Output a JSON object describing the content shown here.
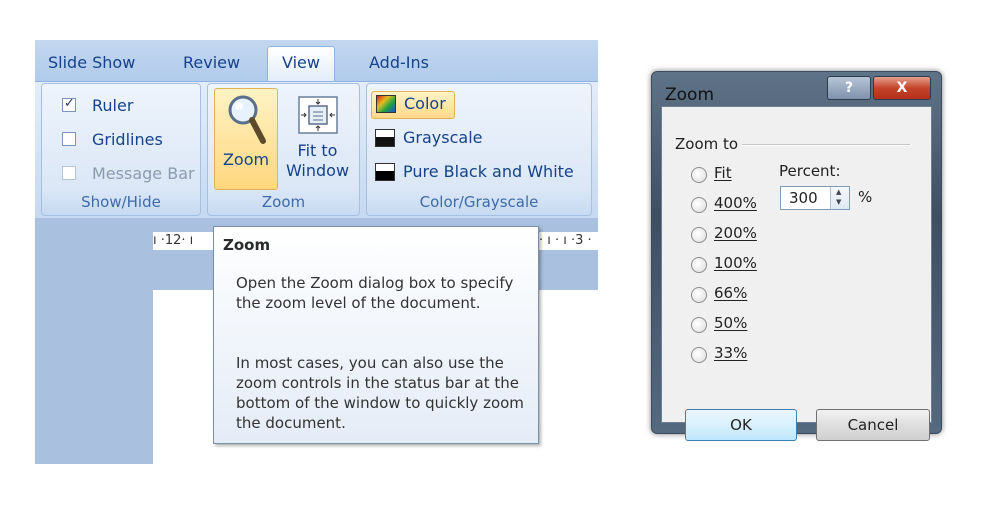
{
  "ribbon": {
    "tabs": [
      {
        "label": "Slide Show",
        "active": false
      },
      {
        "label": "Review",
        "active": false
      },
      {
        "label": "View",
        "active": true
      },
      {
        "label": "Add-Ins",
        "active": false
      }
    ],
    "show_hide": {
      "group_label": "Show/Hide",
      "items": [
        {
          "label": "Ruler",
          "checked": true,
          "enabled": true
        },
        {
          "label": "Gridlines",
          "checked": false,
          "enabled": true
        },
        {
          "label": "Message Bar",
          "checked": false,
          "enabled": false
        }
      ]
    },
    "zoom": {
      "group_label": "Zoom",
      "zoom_button": "Zoom",
      "fit_line1": "Fit to",
      "fit_line2": "Window"
    },
    "color": {
      "group_label": "Color/Grayscale",
      "items": [
        {
          "label": "Color",
          "selected": true
        },
        {
          "label": "Grayscale",
          "selected": false
        },
        {
          "label": "Pure Black and White",
          "selected": false
        }
      ]
    }
  },
  "ruler": {
    "left_text": "ı ·12· ı",
    "right_text": "· ı · ı ·3 ·"
  },
  "tooltip": {
    "title": "Zoom",
    "para1": "Open the Zoom dialog box to specify the zoom level of the document.",
    "para2": "In most cases, you can also use the zoom controls in the status bar at the bottom of the window to quickly zoom the document."
  },
  "dialog": {
    "title": "Zoom",
    "help_glyph": "?",
    "close_glyph": "X",
    "group_label": "Zoom to",
    "options": [
      "Fit",
      "400%",
      "200%",
      "100%",
      "66%",
      "50%",
      "33%"
    ],
    "percent_label": "Percent:",
    "percent_value": "300",
    "percent_sign": "%",
    "ok_label": "OK",
    "cancel_label": "Cancel"
  }
}
